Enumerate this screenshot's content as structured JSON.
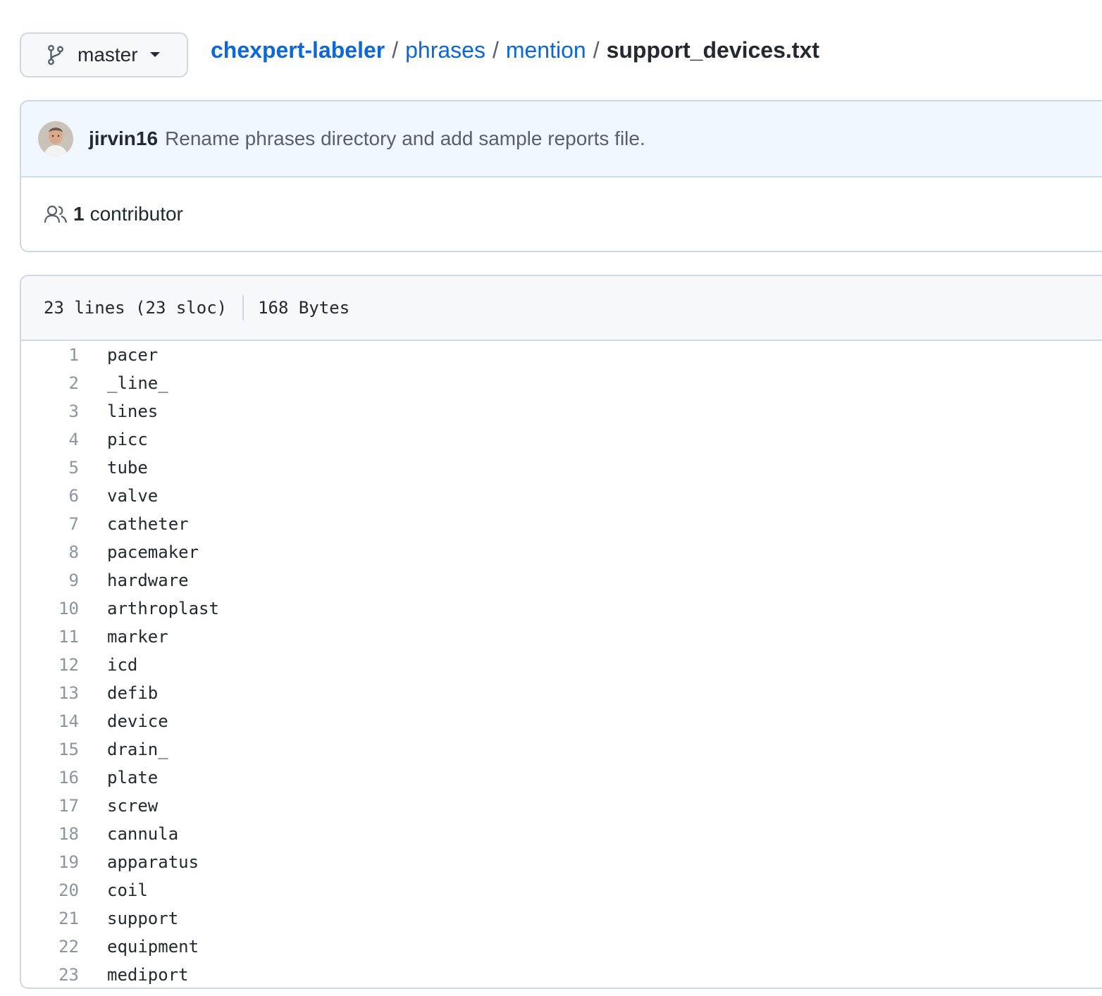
{
  "branch": {
    "name": "master",
    "icon": "git-branch-icon"
  },
  "breadcrumb": {
    "repo": "chexpert-labeler",
    "dirs": [
      "phrases",
      "mention"
    ],
    "separator": "/",
    "file": "support_devices.txt"
  },
  "commit": {
    "author": "jirvin16",
    "message": "Rename phrases directory and add sample reports file."
  },
  "contributors": {
    "count": "1",
    "label": "contributor",
    "icon": "people-icon"
  },
  "file_info": {
    "lines": "23 lines (23 sloc)",
    "size": "168 Bytes"
  },
  "code": [
    {
      "n": "1",
      "text": "pacer"
    },
    {
      "n": "2",
      "text": "_line_"
    },
    {
      "n": "3",
      "text": "lines"
    },
    {
      "n": "4",
      "text": "picc"
    },
    {
      "n": "5",
      "text": "tube"
    },
    {
      "n": "6",
      "text": "valve"
    },
    {
      "n": "7",
      "text": "catheter"
    },
    {
      "n": "8",
      "text": "pacemaker"
    },
    {
      "n": "9",
      "text": "hardware"
    },
    {
      "n": "10",
      "text": "arthroplast"
    },
    {
      "n": "11",
      "text": "marker"
    },
    {
      "n": "12",
      "text": "icd"
    },
    {
      "n": "13",
      "text": "defib"
    },
    {
      "n": "14",
      "text": "device"
    },
    {
      "n": "15",
      "text": "drain_"
    },
    {
      "n": "16",
      "text": "plate"
    },
    {
      "n": "17",
      "text": "screw"
    },
    {
      "n": "18",
      "text": "cannula"
    },
    {
      "n": "19",
      "text": "apparatus"
    },
    {
      "n": "20",
      "text": "coil"
    },
    {
      "n": "21",
      "text": "support"
    },
    {
      "n": "22",
      "text": "equipment"
    },
    {
      "n": "23",
      "text": "mediport"
    }
  ],
  "colors": {
    "link": "#0969da",
    "text": "#24292f",
    "muted": "#57606a",
    "border": "#d0d7de",
    "commit_bg": "#f1f7ff",
    "header_bg": "#f6f8fa"
  }
}
